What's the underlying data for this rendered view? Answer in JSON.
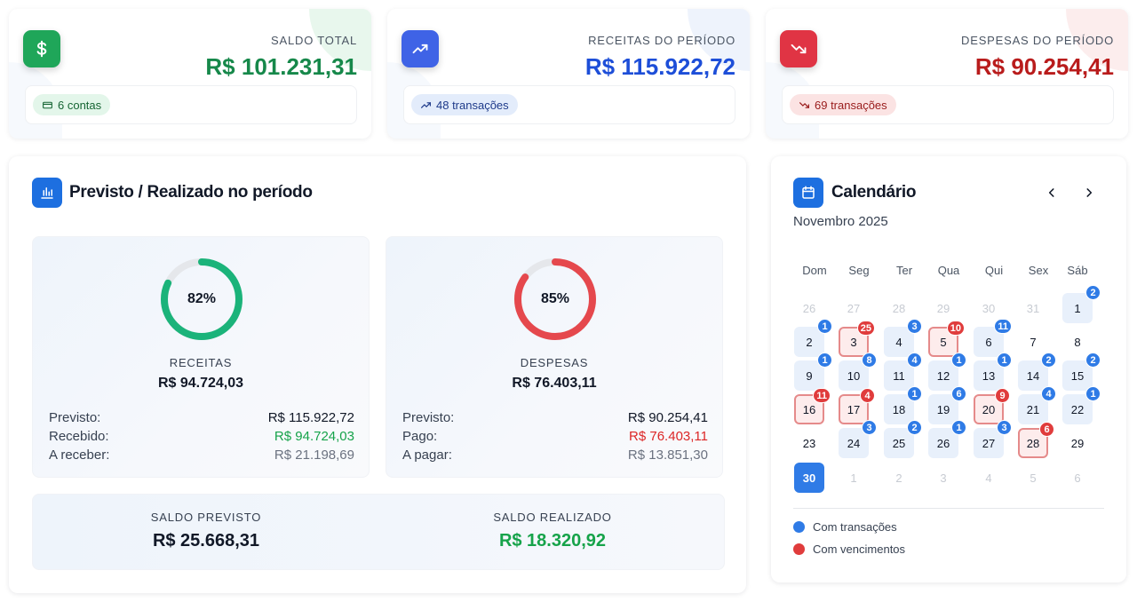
{
  "cards": [
    {
      "label": "SALDO TOTAL",
      "value": "R$ 101.231,31",
      "pill": "6 contas",
      "color": "#16884a",
      "icon": "dollar-icon"
    },
    {
      "label": "RECEITAS DO PERÍODO",
      "value": "R$ 115.922,72",
      "pill": "48 transações",
      "color": "#1d4ed8",
      "icon": "trending-up-icon"
    },
    {
      "label": "DESPESAS DO PERÍODO",
      "value": "R$ 90.254,41",
      "pill": "69 transações",
      "color": "#b91c1c",
      "icon": "trending-down-icon"
    }
  ],
  "panel": {
    "title": "Previsto / Realizado no período",
    "receitas": {
      "percent": "82%",
      "percent_value": 0.82,
      "label": "RECEITAS",
      "value": "R$ 94.724,03",
      "rows": [
        {
          "label": "Previsto:",
          "value": "R$ 115.922,72"
        },
        {
          "label": "Recebido:",
          "value": "R$ 94.724,03"
        },
        {
          "label": "A receber:",
          "value": "R$ 21.198,69"
        }
      ]
    },
    "despesas": {
      "percent": "85%",
      "percent_value": 0.85,
      "label": "DESPESAS",
      "value": "R$ 76.403,11",
      "rows": [
        {
          "label": "Previsto:",
          "value": "R$ 90.254,41"
        },
        {
          "label": "Pago:",
          "value": "R$ 76.403,11"
        },
        {
          "label": "A pagar:",
          "value": "R$ 13.851,30"
        }
      ]
    },
    "saldo_previsto": {
      "label": "SALDO PREVISTO",
      "value": "R$ 25.668,31"
    },
    "saldo_realizado": {
      "label": "SALDO REALIZADO",
      "value": "R$ 18.320,92"
    }
  },
  "calendar": {
    "title": "Calendário",
    "month": "Novembro 2025",
    "weekdays": [
      "Dom",
      "Seg",
      "Ter",
      "Qua",
      "Qui",
      "Sex",
      "Sáb"
    ],
    "weeks": [
      [
        {
          "d": "26",
          "m": true
        },
        {
          "d": "27",
          "m": true
        },
        {
          "d": "28",
          "m": true
        },
        {
          "d": "29",
          "m": true
        },
        {
          "d": "30",
          "m": true
        },
        {
          "d": "31",
          "m": true
        },
        {
          "d": "1",
          "s": "tx",
          "b": "2",
          "bc": "blue"
        }
      ],
      [
        {
          "d": "2",
          "s": "tx",
          "b": "1",
          "bc": "blue"
        },
        {
          "d": "3",
          "s": "due",
          "b": "25",
          "bc": "red"
        },
        {
          "d": "4",
          "s": "tx",
          "b": "3",
          "bc": "blue"
        },
        {
          "d": "5",
          "s": "due",
          "b": "10",
          "bc": "red"
        },
        {
          "d": "6",
          "s": "tx",
          "b": "11",
          "bc": "blue"
        },
        {
          "d": "7"
        },
        {
          "d": "8"
        }
      ],
      [
        {
          "d": "9",
          "s": "tx",
          "b": "1",
          "bc": "blue"
        },
        {
          "d": "10",
          "s": "tx",
          "b": "8",
          "bc": "blue"
        },
        {
          "d": "11",
          "s": "tx",
          "b": "4",
          "bc": "blue"
        },
        {
          "d": "12",
          "s": "tx",
          "b": "1",
          "bc": "blue"
        },
        {
          "d": "13",
          "s": "tx",
          "b": "1",
          "bc": "blue"
        },
        {
          "d": "14",
          "s": "tx",
          "b": "2",
          "bc": "blue"
        },
        {
          "d": "15",
          "s": "tx",
          "b": "2",
          "bc": "blue"
        }
      ],
      [
        {
          "d": "16",
          "s": "due",
          "b": "11",
          "bc": "red"
        },
        {
          "d": "17",
          "s": "due",
          "b": "4",
          "bc": "red"
        },
        {
          "d": "18",
          "s": "tx",
          "b": "1",
          "bc": "blue"
        },
        {
          "d": "19",
          "s": "tx",
          "b": "6",
          "bc": "blue"
        },
        {
          "d": "20",
          "s": "due",
          "b": "9",
          "bc": "red"
        },
        {
          "d": "21",
          "s": "tx",
          "b": "4",
          "bc": "blue"
        },
        {
          "d": "22",
          "s": "tx",
          "b": "1",
          "bc": "blue"
        }
      ],
      [
        {
          "d": "23"
        },
        {
          "d": "24",
          "s": "tx",
          "b": "3",
          "bc": "blue"
        },
        {
          "d": "25",
          "s": "tx",
          "b": "2",
          "bc": "blue"
        },
        {
          "d": "26",
          "s": "tx",
          "b": "1",
          "bc": "blue"
        },
        {
          "d": "27",
          "s": "tx",
          "b": "3",
          "bc": "blue"
        },
        {
          "d": "28",
          "s": "due",
          "b": "6",
          "bc": "red"
        },
        {
          "d": "29"
        }
      ],
      [
        {
          "d": "30",
          "s": "today"
        },
        {
          "d": "1",
          "m": true
        },
        {
          "d": "2",
          "m": true
        },
        {
          "d": "3",
          "m": true
        },
        {
          "d": "4",
          "m": true
        },
        {
          "d": "5",
          "m": true
        },
        {
          "d": "6",
          "m": true
        }
      ]
    ],
    "legend": [
      {
        "label": "Com transações",
        "color": "#2f7be6"
      },
      {
        "label": "Com vencimentos",
        "color": "#e03c3c"
      }
    ]
  },
  "colors": {
    "green": "#16a34a",
    "red": "#dc2626",
    "blue": "#1d6fe0",
    "gray": "#6b7280",
    "ring_green": "#1bb37a",
    "ring_red": "#e5484d",
    "ring_track": "#e5e7eb"
  }
}
